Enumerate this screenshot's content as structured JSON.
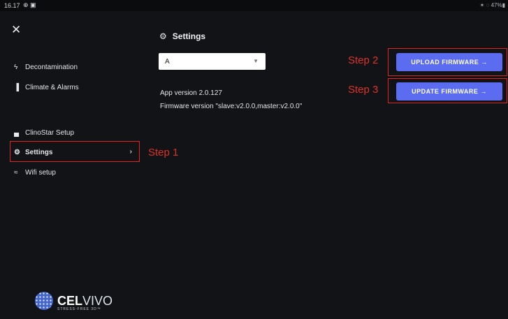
{
  "statusbar": {
    "time": "16.17",
    "icons_left": "⊕ ▣",
    "right_text": "✶ ◌ 47%▮"
  },
  "sidebar": {
    "items": [
      {
        "label": "Decontamination",
        "icon": "bolt-icon",
        "glyph": "ϟ"
      },
      {
        "label": "Climate & Alarms",
        "icon": "thermometer-icon",
        "glyph": "▐"
      },
      {
        "label": "ClinoStar Setup",
        "icon": "grid-icon",
        "glyph": "▄"
      },
      {
        "label": "Settings",
        "icon": "gear-icon",
        "glyph": "⚙",
        "active": true
      },
      {
        "label": "Wifi setup",
        "icon": "wifi-icon",
        "glyph": "≈"
      }
    ],
    "settings_chevron": "›"
  },
  "logo": {
    "brand_bold": "CEL",
    "brand_thin": "VIVO",
    "tagline": "STRESS-FREE 3D™"
  },
  "main": {
    "title": "Settings",
    "device_select": {
      "value": "A"
    },
    "app_version": "App version 2.0.127",
    "firmware_version": "Firmware version \"slave:v2.0.0,master:v2.0.0\"",
    "upload_button": "UPLOAD FIRMWARE →",
    "update_button": "UPDATE FIRMWARE →"
  },
  "annotations": {
    "step1": "Step 1",
    "step2": "Step 2",
    "step3": "Step 3"
  },
  "colors": {
    "background": "#121316",
    "button": "#5b6cf0",
    "annotation": "#e0241f"
  }
}
